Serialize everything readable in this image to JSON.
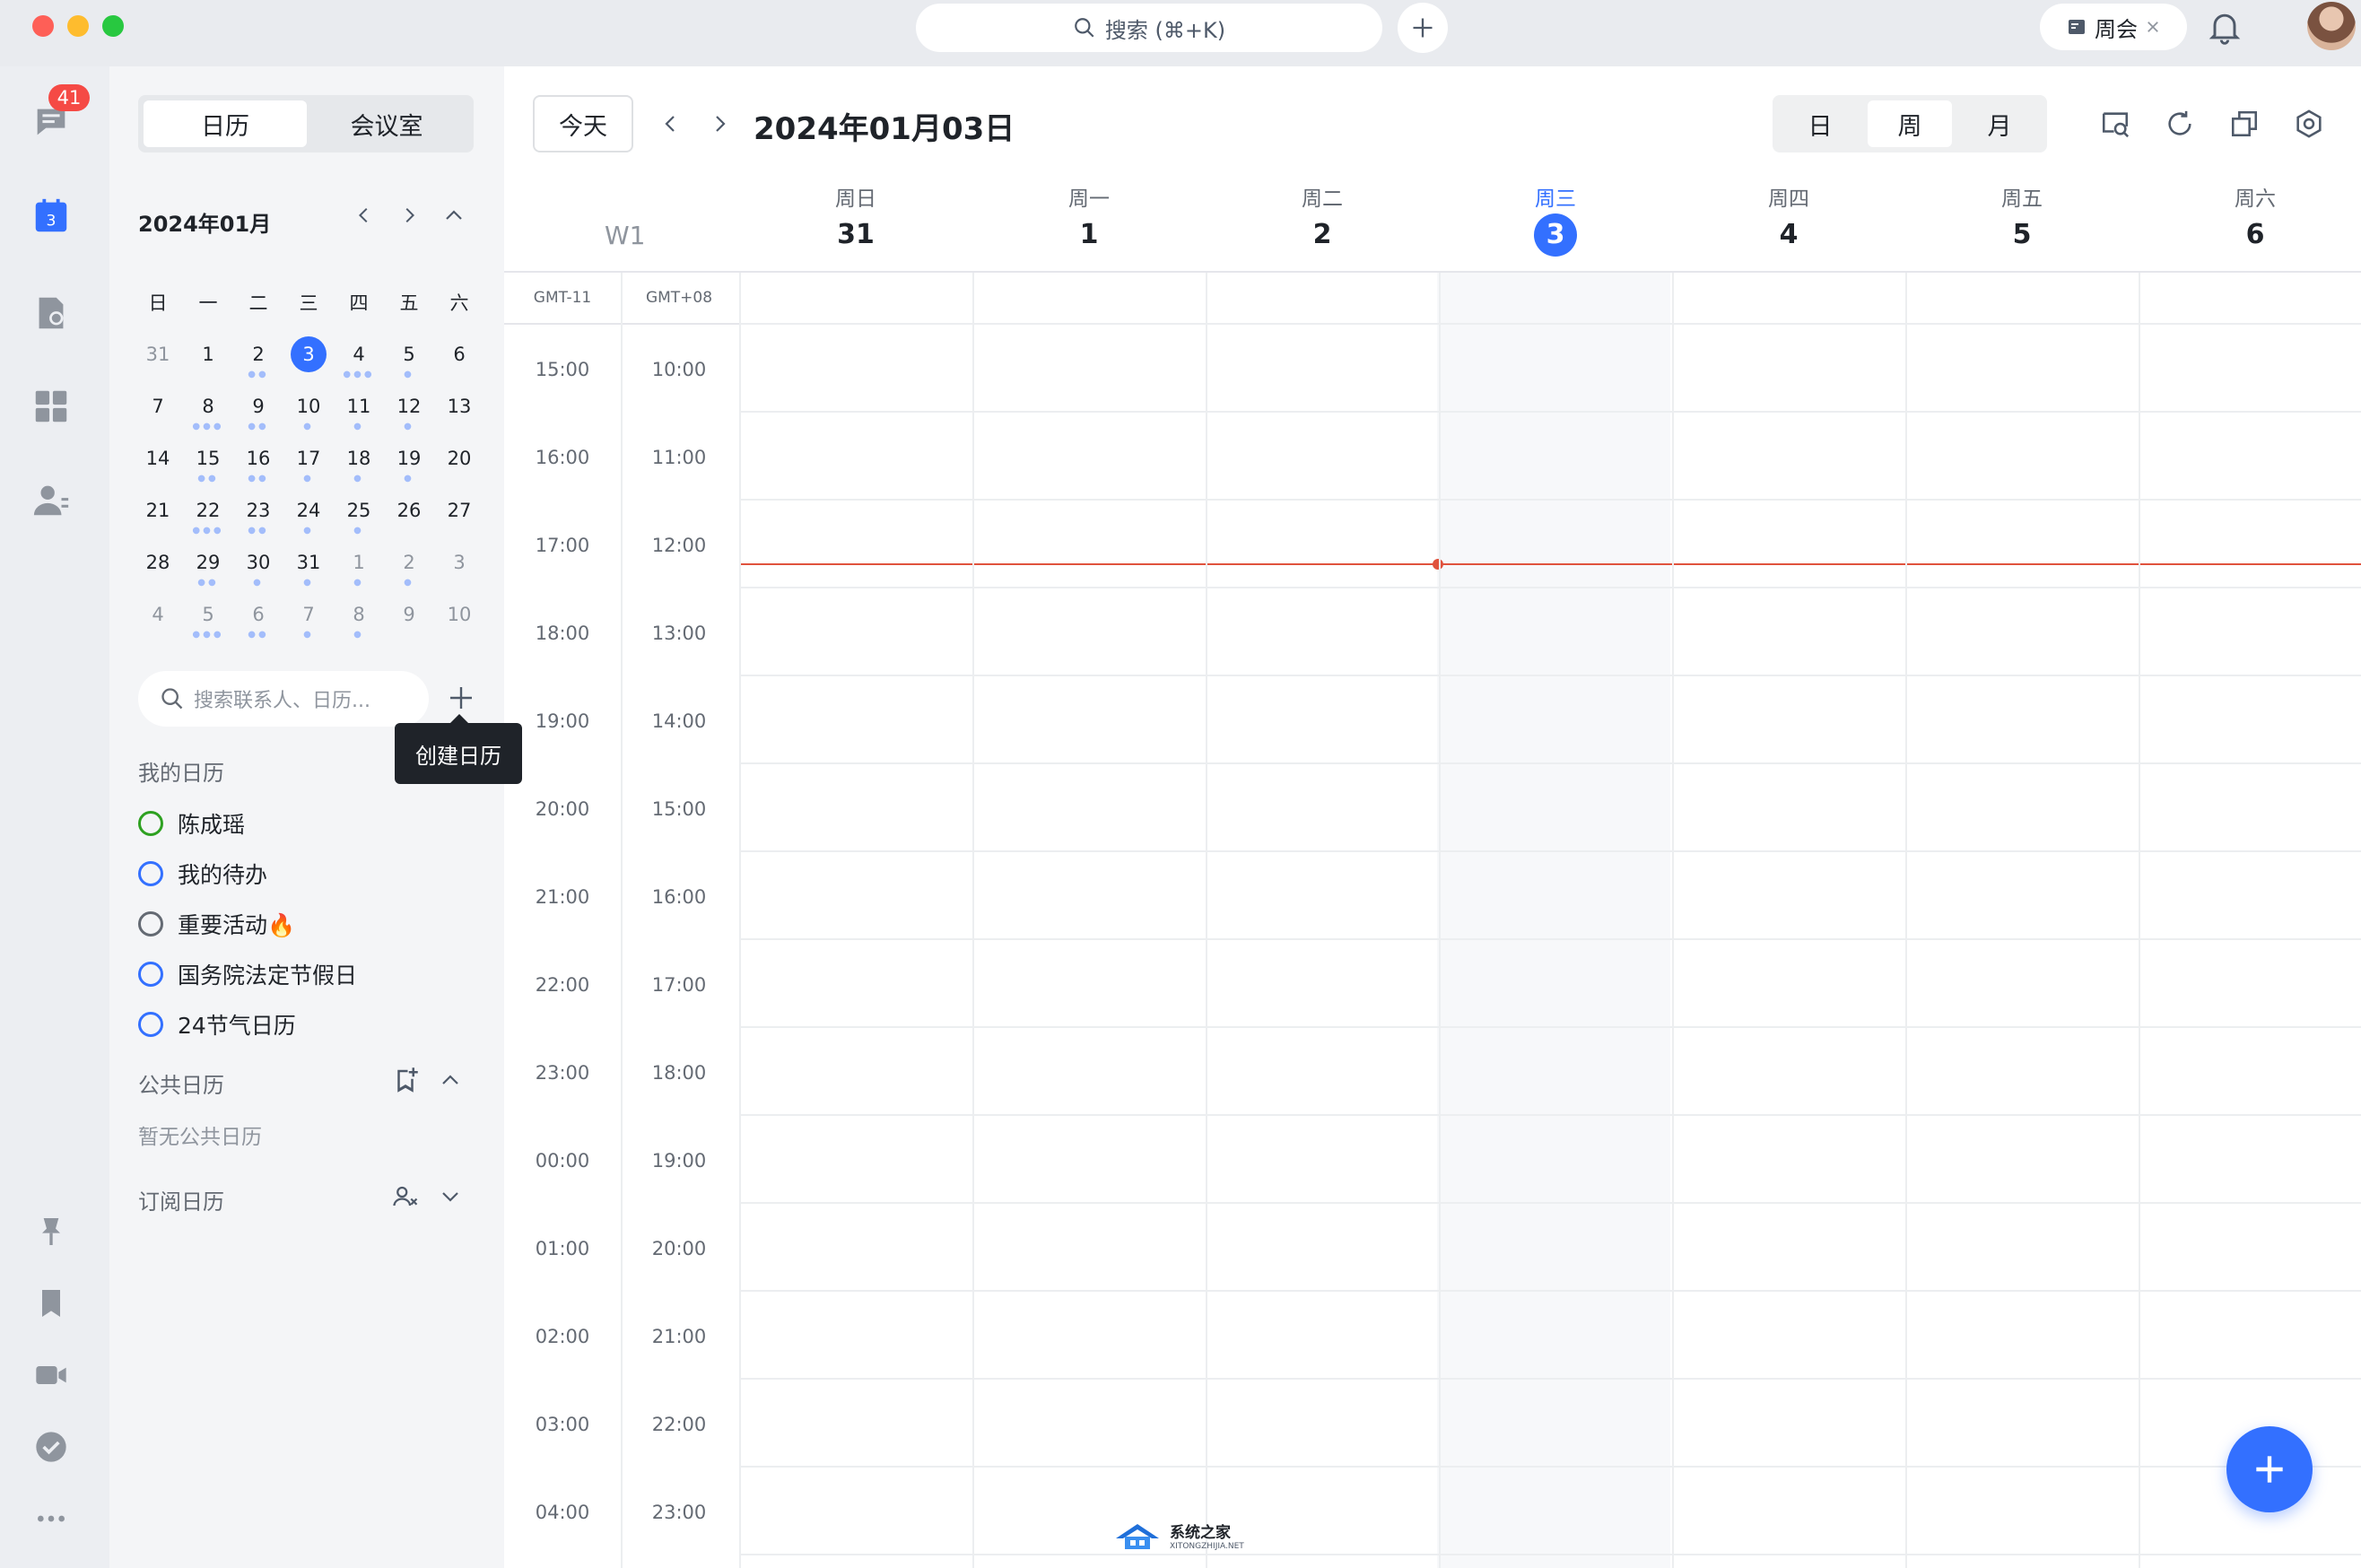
{
  "titlebar": {
    "search_text": "搜索 (⌘+K)",
    "meeting_chip": "周会"
  },
  "rail": {
    "badge": "41",
    "calendar_icon_day": "3",
    "icons": [
      "chat-icon",
      "calendar-icon",
      "docs-icon",
      "apps-icon",
      "contacts-icon",
      "pin-icon",
      "bookmark-icon",
      "video-icon",
      "check-icon",
      "more-icon"
    ]
  },
  "sidebar": {
    "tabs": [
      "日历",
      "会议室"
    ],
    "mini_cal": {
      "title": "2024年01月",
      "weekdays": [
        "日",
        "一",
        "二",
        "三",
        "四",
        "五",
        "六"
      ],
      "weeks": [
        [
          {
            "d": "31",
            "m": true,
            "dots": 0
          },
          {
            "d": "1",
            "dots": 0
          },
          {
            "d": "2",
            "dots": 2
          },
          {
            "d": "3",
            "today": true,
            "dots": 0
          },
          {
            "d": "4",
            "dots": 3
          },
          {
            "d": "5",
            "dots": 1
          },
          {
            "d": "6",
            "dots": 0
          }
        ],
        [
          {
            "d": "7",
            "dots": 0
          },
          {
            "d": "8",
            "dots": 3
          },
          {
            "d": "9",
            "dots": 2
          },
          {
            "d": "10",
            "dots": 1
          },
          {
            "d": "11",
            "dots": 1
          },
          {
            "d": "12",
            "dots": 1
          },
          {
            "d": "13",
            "dots": 0
          }
        ],
        [
          {
            "d": "14",
            "dots": 0
          },
          {
            "d": "15",
            "dots": 2
          },
          {
            "d": "16",
            "dots": 2
          },
          {
            "d": "17",
            "dots": 1
          },
          {
            "d": "18",
            "dots": 1
          },
          {
            "d": "19",
            "dots": 1
          },
          {
            "d": "20",
            "dots": 0
          }
        ],
        [
          {
            "d": "21",
            "dots": 0
          },
          {
            "d": "22",
            "dots": 3
          },
          {
            "d": "23",
            "dots": 2
          },
          {
            "d": "24",
            "dots": 1
          },
          {
            "d": "25",
            "dots": 1
          },
          {
            "d": "26",
            "dots": 0
          },
          {
            "d": "27",
            "dots": 0
          }
        ],
        [
          {
            "d": "28",
            "dots": 0
          },
          {
            "d": "29",
            "dots": 2
          },
          {
            "d": "30",
            "dots": 1
          },
          {
            "d": "31",
            "dots": 1
          },
          {
            "d": "1",
            "m": true,
            "dots": 1
          },
          {
            "d": "2",
            "m": true,
            "dots": 1
          },
          {
            "d": "3",
            "m": true,
            "dots": 0
          }
        ],
        [
          {
            "d": "4",
            "m": true,
            "dots": 0
          },
          {
            "d": "5",
            "m": true,
            "dots": 3
          },
          {
            "d": "6",
            "m": true,
            "dots": 2
          },
          {
            "d": "7",
            "m": true,
            "dots": 1
          },
          {
            "d": "8",
            "m": true,
            "dots": 1
          },
          {
            "d": "9",
            "m": true,
            "dots": 0
          },
          {
            "d": "10",
            "m": true,
            "dots": 0
          }
        ]
      ]
    },
    "search_placeholder": "搜索联系人、日历...",
    "tooltip": "创建日历",
    "my_calendars_title": "我的日历",
    "my_calendars": [
      {
        "label": "陈成瑶",
        "color": "#2ea121"
      },
      {
        "label": "我的待办",
        "color": "#3370ff"
      },
      {
        "label": "重要活动🔥",
        "color": "#646a73"
      },
      {
        "label": "国务院法定节假日",
        "color": "#3370ff"
      },
      {
        "label": "24节气日历",
        "color": "#3370ff"
      }
    ],
    "public_title": "公共日历",
    "public_empty": "暂无公共日历",
    "subscribed_title": "订阅日历"
  },
  "toolbar": {
    "today": "今天",
    "date": "2024年01月03日",
    "views": [
      "日",
      "周",
      "月"
    ],
    "active_view": "周"
  },
  "week": {
    "label": "W1",
    "days": [
      {
        "dow": "周日",
        "num": "31"
      },
      {
        "dow": "周一",
        "num": "1"
      },
      {
        "dow": "周二",
        "num": "2"
      },
      {
        "dow": "周三",
        "num": "3",
        "today": true
      },
      {
        "dow": "周四",
        "num": "4"
      },
      {
        "dow": "周五",
        "num": "5"
      },
      {
        "dow": "周六",
        "num": "6"
      }
    ]
  },
  "timezones": {
    "left_label": "GMT-11",
    "right_label": "GMT+08",
    "left_times": [
      "15:00",
      "16:00",
      "17:00",
      "18:00",
      "19:00",
      "20:00",
      "21:00",
      "22:00",
      "23:00",
      "00:00",
      "01:00",
      "02:00",
      "03:00",
      "04:00"
    ],
    "right_times": [
      "10:00",
      "11:00",
      "12:00",
      "13:00",
      "14:00",
      "15:00",
      "16:00",
      "17:00",
      "18:00",
      "19:00",
      "20:00",
      "21:00",
      "22:00",
      "23:00"
    ]
  },
  "watermark": {
    "main": "系统之家",
    "sub": "XITONGZHIJIA.NET"
  },
  "colors": {
    "accent": "#3370ff",
    "now_line": "#e0523d",
    "badge": "#f54a45"
  }
}
